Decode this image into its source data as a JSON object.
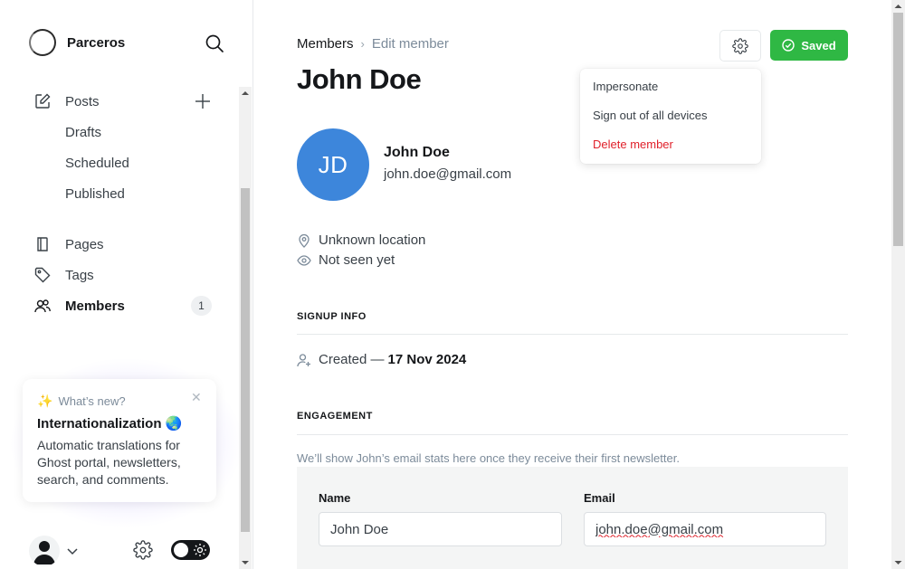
{
  "brand": {
    "name": "Parceros"
  },
  "sidebar": {
    "items": [
      {
        "label": "Posts",
        "icon": "edit-icon"
      },
      {
        "label": "Drafts"
      },
      {
        "label": "Scheduled"
      },
      {
        "label": "Published"
      },
      {
        "label": "Pages",
        "icon": "page-icon"
      },
      {
        "label": "Tags",
        "icon": "tag-icon"
      },
      {
        "label": "Members",
        "icon": "members-icon",
        "count": "1"
      }
    ]
  },
  "whats_new": {
    "heading": "What’s new?",
    "title": "Internationalization 🌏",
    "body": "Automatic translations for Ghost portal, newsletters, search, and comments."
  },
  "breadcrumb": {
    "parent": "Members",
    "current": "Edit member"
  },
  "page_title": "John Doe",
  "toolbar": {
    "saved_label": "Saved"
  },
  "dropdown": {
    "items": [
      "Impersonate",
      "Sign out of all devices",
      "Delete member"
    ]
  },
  "member": {
    "initials": "JD",
    "name": "John Doe",
    "email": "john.doe@gmail.com",
    "avatar_color": "#3d86db",
    "location": "Unknown location",
    "last_seen": "Not seen yet"
  },
  "signup_info": {
    "title": "SIGNUP INFO",
    "created_prefix": "Created —",
    "created_date": "17 Nov 2024"
  },
  "engagement": {
    "title": "ENGAGEMENT",
    "note": "We’ll show John’s email stats here once they receive their first newsletter."
  },
  "form": {
    "name_label": "Name",
    "name_value": "John Doe",
    "email_label": "Email",
    "email_value": "john.doe@gmail.com"
  },
  "colors": {
    "accent": "#2fb844",
    "danger": "#e0212b"
  }
}
